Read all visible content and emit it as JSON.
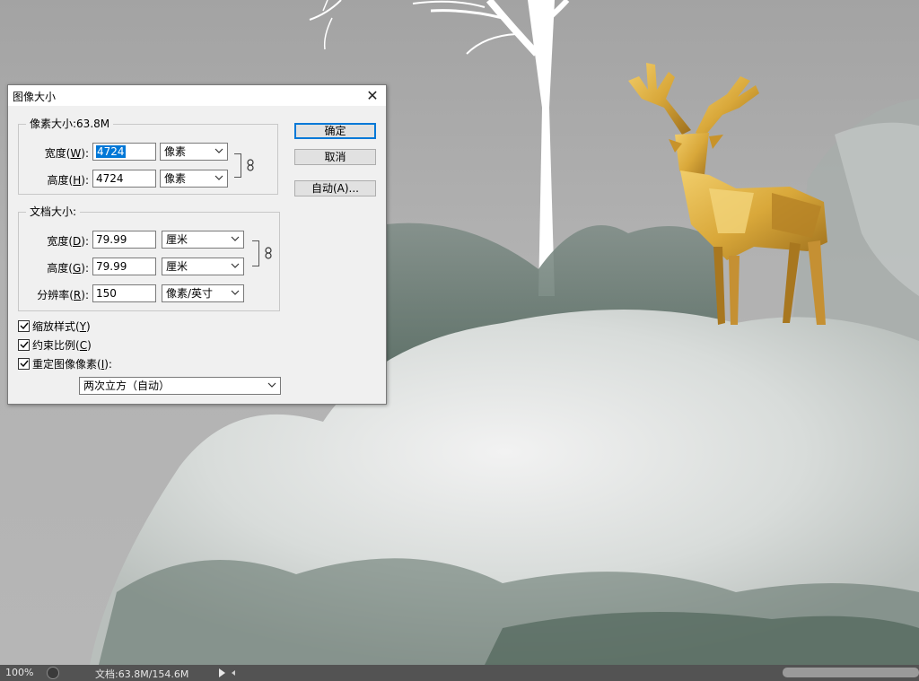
{
  "dialog": {
    "title": "图像大小",
    "close_glyph": "✕",
    "pixel_dimensions": {
      "legend": "像素大小:63.8M",
      "width_label": "宽度(",
      "width_key": "W",
      "label_close": "):",
      "width_value": "4724",
      "width_unit": "像素",
      "height_label": "高度(",
      "height_key": "H",
      "height_value": "4724",
      "height_unit": "像素"
    },
    "document_size": {
      "legend": "文档大小:",
      "width_label": "宽度(",
      "width_key": "D",
      "width_value": "79.99",
      "width_unit": "厘米",
      "height_label": "高度(",
      "height_key": "G",
      "height_value": "79.99",
      "height_unit": "厘米",
      "resolution_label": "分辨率(",
      "resolution_key": "R",
      "resolution_value": "150",
      "resolution_unit": "像素/英寸"
    },
    "buttons": {
      "ok": "确定",
      "cancel": "取消",
      "auto": "自动(A)..."
    },
    "options": {
      "scale_styles_label": "缩放样式(",
      "scale_styles_key": "Y",
      "constrain_label": "约束比例(",
      "constrain_key": "C",
      "resample_label": "重定图像像素(",
      "resample_key": "I",
      "close_paren": ")",
      "resample_colon": ":",
      "interpolation": "两次立方（自动）"
    }
  },
  "statusbar": {
    "zoom": "100%",
    "doc_info": "文档:63.8M/154.6M"
  },
  "colors": {
    "accent": "#0078d7",
    "statusbar_bg": "#535353",
    "deer_gold": "#d9a83a"
  }
}
